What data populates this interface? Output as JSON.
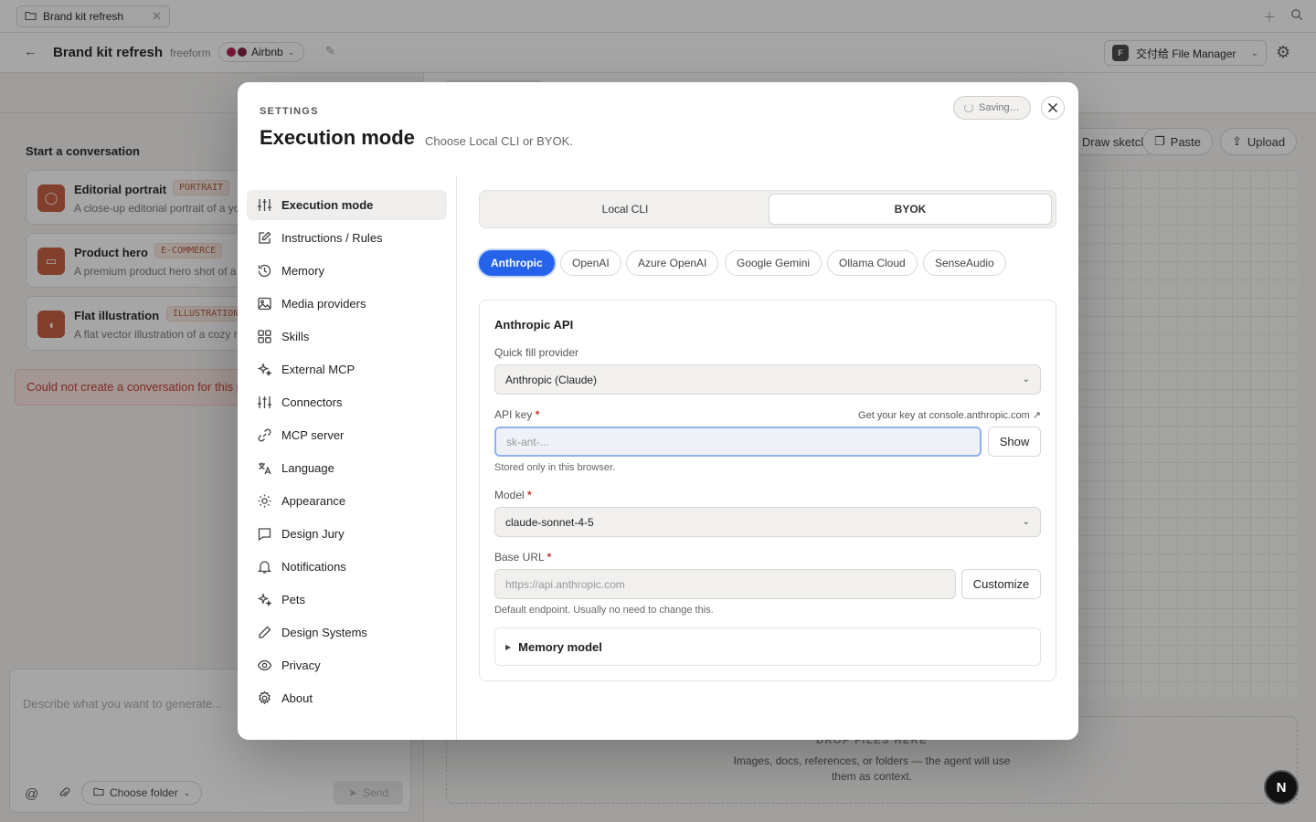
{
  "tab": {
    "title": "Brand kit refresh"
  },
  "header": {
    "project_title": "Brand kit refresh",
    "mode": "freeform",
    "design_system": "Airbnb",
    "file_manager": "交付给 File Manager",
    "file_manager_badge": "F"
  },
  "left": {
    "start_title": "Start a conversation",
    "cards": [
      {
        "title": "Editorial portrait",
        "tag": "PORTRAIT",
        "desc": "A close-up editorial portrait of a young"
      },
      {
        "title": "Product hero",
        "tag": "E-COMMERCE",
        "desc": "A premium product hero shot of a minim"
      },
      {
        "title": "Flat illustration",
        "tag": "ILLUSTRATION",
        "desc": "A flat vector illustration of a cozy rea"
      }
    ],
    "error": "Could not create a conversation for this project.",
    "composer_placeholder": "Describe what you want to generate...",
    "choose_folder": "Choose folder",
    "send": "Send"
  },
  "right": {
    "tools": [
      "Draw sketch",
      "Paste",
      "Upload"
    ],
    "drop_title": "DROP FILES HERE",
    "drop_desc": "Images, docs, references, or folders — the agent will use them as context."
  },
  "fab": "N",
  "modal": {
    "eyebrow": "SETTINGS",
    "title": "Execution mode",
    "subtitle": "Choose Local CLI or BYOK.",
    "saving": "Saving…",
    "nav": [
      {
        "label": "Execution mode",
        "icon": "sliders-icon",
        "active": true
      },
      {
        "label": "Instructions / Rules",
        "icon": "edit-icon"
      },
      {
        "label": "Memory",
        "icon": "history-icon"
      },
      {
        "label": "Media providers",
        "icon": "image-icon"
      },
      {
        "label": "Skills",
        "icon": "grid-icon"
      },
      {
        "label": "External MCP",
        "icon": "sparkle-icon"
      },
      {
        "label": "Connectors",
        "icon": "sliders-icon"
      },
      {
        "label": "MCP server",
        "icon": "link-icon"
      },
      {
        "label": "Language",
        "icon": "translate-icon"
      },
      {
        "label": "Appearance",
        "icon": "sun-icon"
      },
      {
        "label": "Design Jury",
        "icon": "chat-icon"
      },
      {
        "label": "Notifications",
        "icon": "bell-icon"
      },
      {
        "label": "Pets",
        "icon": "sparkle-icon"
      },
      {
        "label": "Design Systems",
        "icon": "pen-icon"
      },
      {
        "label": "Privacy",
        "icon": "eye-icon"
      },
      {
        "label": "About",
        "icon": "gear-icon"
      }
    ],
    "segment": {
      "left": "Local CLI",
      "right": "BYOK",
      "selected": "BYOK"
    },
    "providers": [
      "Anthropic",
      "OpenAI",
      "Azure OpenAI",
      "Google Gemini",
      "Ollama Cloud",
      "SenseAudio"
    ],
    "selected_provider": "Anthropic",
    "api": {
      "heading": "Anthropic API",
      "quick_fill_label": "Quick fill provider",
      "quick_fill_value": "Anthropic (Claude)",
      "api_key_label": "API key",
      "api_key_hint": "Get your key at console.anthropic.com ↗",
      "api_key_placeholder": "sk-ant-...",
      "show": "Show",
      "api_key_help": "Stored only in this browser.",
      "model_label": "Model",
      "model_value": "claude-sonnet-4-5",
      "base_url_label": "Base URL",
      "base_url_placeholder": "https://api.anthropic.com",
      "customize": "Customize",
      "base_url_help": "Default endpoint. Usually no need to change this.",
      "memory_model": "Memory model"
    }
  }
}
